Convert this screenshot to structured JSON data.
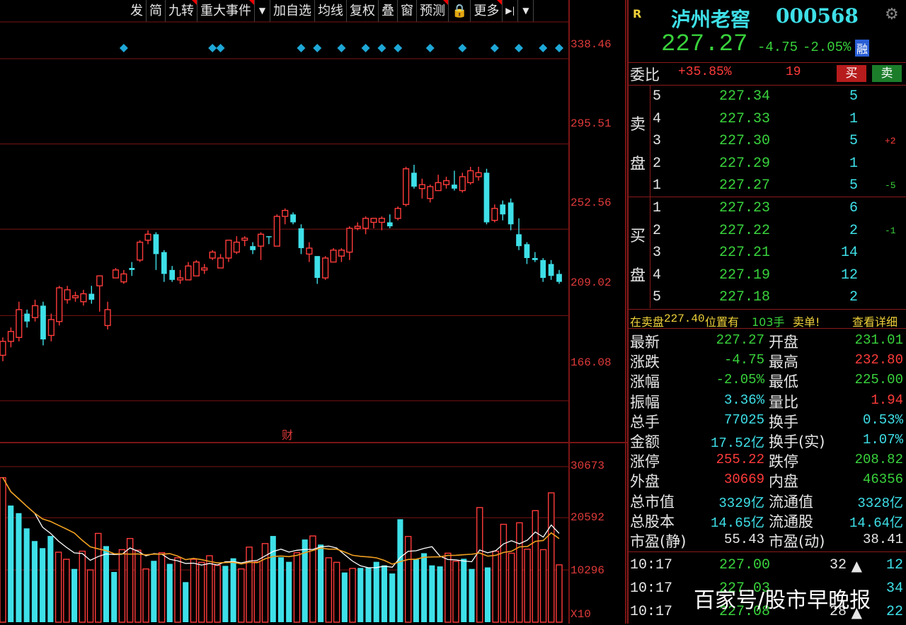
{
  "toolbar": {
    "items": [
      "发",
      "简",
      "九转",
      "重大事件",
      "▼",
      "加自选",
      "均线",
      "复权",
      "叠",
      "窗",
      "预测",
      "🔒",
      "更多",
      "▶|",
      "▼"
    ],
    "marked": [
      false,
      false,
      true,
      true,
      false,
      false,
      false,
      false,
      false,
      false,
      true,
      false,
      true,
      false,
      false
    ]
  },
  "price_axis": [
    "338.46",
    "295.51",
    "252.56",
    "209.02",
    "166.08"
  ],
  "volume_axis": [
    "30673",
    "20592",
    "10296",
    "X10"
  ],
  "fin_marker": "财",
  "chart_data": [
    {
      "type": "candlestick",
      "ylim": [
        145,
        357
      ],
      "y_ticks": [
        338.46,
        295.51,
        252.56,
        209.02,
        166.08
      ],
      "candles": [
        [
          189,
          196,
          186,
          198,
          1
        ],
        [
          196,
          201,
          193,
          203,
          1
        ],
        [
          198,
          212,
          196,
          216,
          1
        ],
        [
          210,
          206,
          203,
          212,
          0
        ],
        [
          208,
          214,
          206,
          217,
          1
        ],
        [
          214,
          197,
          194,
          216,
          0
        ],
        [
          199,
          207,
          196,
          210,
          1
        ],
        [
          206,
          223,
          204,
          224,
          1
        ],
        [
          217,
          222,
          215,
          224,
          1
        ],
        [
          218,
          219,
          216,
          221,
          1
        ],
        [
          216,
          220,
          214,
          222,
          1
        ],
        [
          220,
          217,
          215,
          224,
          0
        ],
        [
          224,
          229,
          211,
          229,
          1
        ],
        [
          204,
          212,
          202,
          216,
          1
        ],
        [
          228,
          232,
          228,
          233,
          1
        ],
        [
          226,
          230,
          225,
          232,
          1
        ],
        [
          233,
          232,
          229,
          236,
          0
        ],
        [
          237,
          246,
          236,
          247,
          1
        ],
        [
          247,
          250,
          245,
          252,
          1
        ],
        [
          250,
          240,
          232,
          251,
          0
        ],
        [
          241,
          230,
          226,
          242,
          0
        ],
        [
          232,
          227,
          226,
          234,
          0
        ],
        [
          227,
          228,
          225,
          232,
          1
        ],
        [
          227,
          234,
          228,
          236,
          1
        ],
        [
          229,
          236,
          229,
          237,
          1
        ],
        [
          232,
          233,
          230,
          235,
          1
        ],
        [
          238,
          241,
          237,
          242,
          1
        ],
        [
          233,
          238,
          233,
          240,
          1
        ],
        [
          238,
          247,
          236,
          247,
          1
        ],
        [
          241,
          246,
          240,
          249,
          1
        ],
        [
          247,
          248,
          244,
          249,
          1
        ],
        [
          244,
          242,
          240,
          246,
          0
        ],
        [
          244,
          250,
          237,
          251,
          1
        ],
        [
          249,
          249,
          245,
          249,
          0
        ],
        [
          244,
          259,
          244,
          260,
          1
        ],
        [
          259,
          262,
          255,
          263,
          1
        ],
        [
          260,
          256,
          255,
          261,
          0
        ],
        [
          253,
          243,
          240,
          255,
          0
        ],
        [
          240,
          243,
          236,
          246,
          1
        ],
        [
          239,
          228,
          225,
          239,
          0
        ],
        [
          228,
          238,
          227,
          239,
          1
        ],
        [
          236,
          242,
          236,
          243,
          1
        ],
        [
          239,
          242,
          236,
          243,
          1
        ],
        [
          241,
          253,
          237,
          254,
          1
        ],
        [
          253,
          254,
          252,
          256,
          1
        ],
        [
          253,
          258,
          250,
          259,
          1
        ],
        [
          256,
          258,
          253,
          258,
          1
        ],
        [
          256,
          258,
          252,
          259,
          1
        ],
        [
          256,
          254,
          253,
          260,
          0
        ],
        [
          258,
          263,
          257,
          264,
          1
        ],
        [
          265,
          283,
          264,
          284,
          1
        ],
        [
          281,
          274,
          273,
          285,
          0
        ],
        [
          273,
          275,
          268,
          278,
          1
        ],
        [
          268,
          274,
          266,
          275,
          1
        ],
        [
          272,
          276,
          272,
          280,
          1
        ],
        [
          275,
          277,
          273,
          279,
          1
        ],
        [
          275,
          273,
          272,
          282,
          0
        ],
        [
          272,
          279,
          271,
          281,
          1
        ],
        [
          276,
          282,
          275,
          284,
          1
        ],
        [
          279,
          281,
          277,
          284,
          1
        ],
        [
          281,
          256,
          255,
          283,
          0
        ],
        [
          257,
          263,
          256,
          265,
          1
        ],
        [
          265,
          260,
          257,
          267,
          0
        ],
        [
          266,
          255,
          252,
          268,
          0
        ],
        [
          250,
          244,
          242,
          258,
          0
        ],
        [
          245,
          238,
          235,
          246,
          0
        ],
        [
          238,
          237,
          236,
          241,
          0
        ],
        [
          237,
          228,
          226,
          238,
          0
        ],
        [
          235,
          229,
          227,
          237,
          0
        ],
        [
          230,
          226,
          225,
          232,
          0
        ]
      ],
      "signals_at_index": [
        15,
        26,
        27,
        37,
        39,
        42,
        45,
        47,
        49,
        53,
        57,
        61,
        64,
        67,
        69
      ]
    },
    {
      "type": "bar",
      "ylim": [
        0,
        30673
      ],
      "volumes": [
        [
          28500,
          0
        ],
        [
          23000,
          1
        ],
        [
          21500,
          1
        ],
        [
          18500,
          1
        ],
        [
          16000,
          1
        ],
        [
          14600,
          1
        ],
        [
          17000,
          1
        ],
        [
          13800,
          0
        ],
        [
          12400,
          0
        ],
        [
          10500,
          1
        ],
        [
          14000,
          0
        ],
        [
          10300,
          0
        ],
        [
          17500,
          0
        ],
        [
          15000,
          1
        ],
        [
          9900,
          1
        ],
        [
          14300,
          0
        ],
        [
          16500,
          0
        ],
        [
          14200,
          0
        ],
        [
          10500,
          0
        ],
        [
          12100,
          1
        ],
        [
          13700,
          0
        ],
        [
          11500,
          1
        ],
        [
          12700,
          0
        ],
        [
          7900,
          1
        ],
        [
          12400,
          0
        ],
        [
          11800,
          0
        ],
        [
          13100,
          0
        ],
        [
          11200,
          0
        ],
        [
          11100,
          1
        ],
        [
          12600,
          1
        ],
        [
          10500,
          0
        ],
        [
          14800,
          0
        ],
        [
          11900,
          0
        ],
        [
          15500,
          0
        ],
        [
          17000,
          1
        ],
        [
          12800,
          1
        ],
        [
          11900,
          1
        ],
        [
          13700,
          0
        ],
        [
          16300,
          1
        ],
        [
          17000,
          0
        ],
        [
          15300,
          1
        ],
        [
          12700,
          0
        ],
        [
          11800,
          0
        ],
        [
          9800,
          1
        ],
        [
          10600,
          0
        ],
        [
          10700,
          1
        ],
        [
          10800,
          1
        ],
        [
          11900,
          1
        ],
        [
          11200,
          1
        ],
        [
          9600,
          1
        ],
        [
          20300,
          1
        ],
        [
          16900,
          0
        ],
        [
          12400,
          1
        ],
        [
          13600,
          1
        ],
        [
          11200,
          1
        ],
        [
          11000,
          1
        ],
        [
          13600,
          0
        ],
        [
          12000,
          0
        ],
        [
          12500,
          1
        ],
        [
          10500,
          1
        ],
        [
          22600,
          0
        ],
        [
          10800,
          1
        ],
        [
          14000,
          0
        ],
        [
          19300,
          0
        ],
        [
          13600,
          0
        ],
        [
          19600,
          0
        ],
        [
          14400,
          0
        ],
        [
          22000,
          0
        ],
        [
          14300,
          0
        ],
        [
          25500,
          0
        ],
        [
          11300,
          0
        ]
      ],
      "ma_fast_color": "#ffffff",
      "ma_slow_color": "#f0a020"
    }
  ],
  "quote": {
    "r_tag": "R",
    "name": "泸州老窖",
    "code": "000568",
    "price": "227.27",
    "change": "-4.75",
    "pct": "-2.05%",
    "badge": "融",
    "weibi_label": "委比",
    "weibi_value": "+35.85%",
    "weibi_count": "19",
    "buy_btn": "买",
    "sell_btn": "卖"
  },
  "asks": [
    {
      "lv": "5",
      "price": "227.34",
      "vol": "5",
      "chg": ""
    },
    {
      "lv": "4",
      "price": "227.33",
      "vol": "1",
      "chg": ""
    },
    {
      "lv": "3",
      "price": "227.30",
      "vol": "5",
      "chg": "+2"
    },
    {
      "lv": "2",
      "price": "227.29",
      "vol": "1",
      "chg": ""
    },
    {
      "lv": "1",
      "price": "227.27",
      "vol": "5",
      "chg": "-5"
    }
  ],
  "bids": [
    {
      "lv": "1",
      "price": "227.23",
      "vol": "6",
      "chg": ""
    },
    {
      "lv": "2",
      "price": "227.22",
      "vol": "2",
      "chg": "-1"
    },
    {
      "lv": "3",
      "price": "227.21",
      "vol": "14",
      "chg": ""
    },
    {
      "lv": "4",
      "price": "227.19",
      "vol": "12",
      "chg": ""
    },
    {
      "lv": "5",
      "price": "227.18",
      "vol": "2",
      "chg": ""
    }
  ],
  "ask_side_labels": [
    "卖",
    "盘"
  ],
  "bid_side_labels": [
    "买",
    "盘"
  ],
  "alert": {
    "prefix": "在卖盘",
    "price": "227.40",
    "mid": "位置有",
    "qty": "103手",
    "tail": "卖单!",
    "link": "查看详细"
  },
  "stats": [
    {
      "l1": "最新",
      "v1": "227.27",
      "c1": "g",
      "l2": "开盘",
      "v2": "231.01",
      "c2": "g"
    },
    {
      "l1": "涨跌",
      "v1": "-4.75",
      "c1": "g",
      "l2": "最高",
      "v2": "232.80",
      "c2": "r"
    },
    {
      "l1": "涨幅",
      "v1": "-2.05%",
      "c1": "g",
      "l2": "最低",
      "v2": "225.00",
      "c2": "g"
    },
    {
      "l1": "振幅",
      "v1": "3.36%",
      "c1": "c",
      "l2": "量比",
      "v2": "1.94",
      "c2": "r"
    },
    {
      "l1": "总手",
      "v1": "77025",
      "c1": "c",
      "l2": "换手",
      "v2": "0.53%",
      "c2": "c"
    },
    {
      "l1": "金额",
      "v1": "17.52亿",
      "c1": "c",
      "l2": "换手(实)",
      "v2": "1.07%",
      "c2": "c"
    },
    {
      "l1": "涨停",
      "v1": "255.22",
      "c1": "r",
      "l2": "跌停",
      "v2": "208.82",
      "c2": "g"
    },
    {
      "l1": "外盘",
      "v1": "30669",
      "c1": "r",
      "l2": "内盘",
      "v2": "46356",
      "c2": "g"
    },
    {
      "l1": "总市值",
      "v1": "3329亿",
      "c1": "c",
      "l2": "流通值",
      "v2": "3328亿",
      "c2": "c"
    },
    {
      "l1": "总股本",
      "v1": "14.65亿",
      "c1": "c",
      "l2": "流通股",
      "v2": "14.64亿",
      "c2": "c"
    },
    {
      "l1": "市盈(静)",
      "v1": "55.43",
      "c1": "w",
      "l2": "市盈(动)",
      "v2": "38.41",
      "c2": "w"
    }
  ],
  "ticks": [
    {
      "time": "10:17",
      "price": "227.00",
      "vol": "32",
      "dir": "up",
      "n": "12"
    },
    {
      "time": "10:17",
      "price": "227.03",
      "vol": "",
      "dir": "",
      "n": "34"
    },
    {
      "time": "10:17",
      "price": "227.08",
      "vol": "28",
      "dir": "up",
      "n": "22"
    }
  ],
  "watermark": "百家号/股市早晚报",
  "colors": {
    "up": "#ff3b3b",
    "down": "#3ee0e8",
    "grid": "#7a1414",
    "green": "#39d23c",
    "cyan": "#3ee0e8",
    "yellow": "#f0d23a"
  }
}
